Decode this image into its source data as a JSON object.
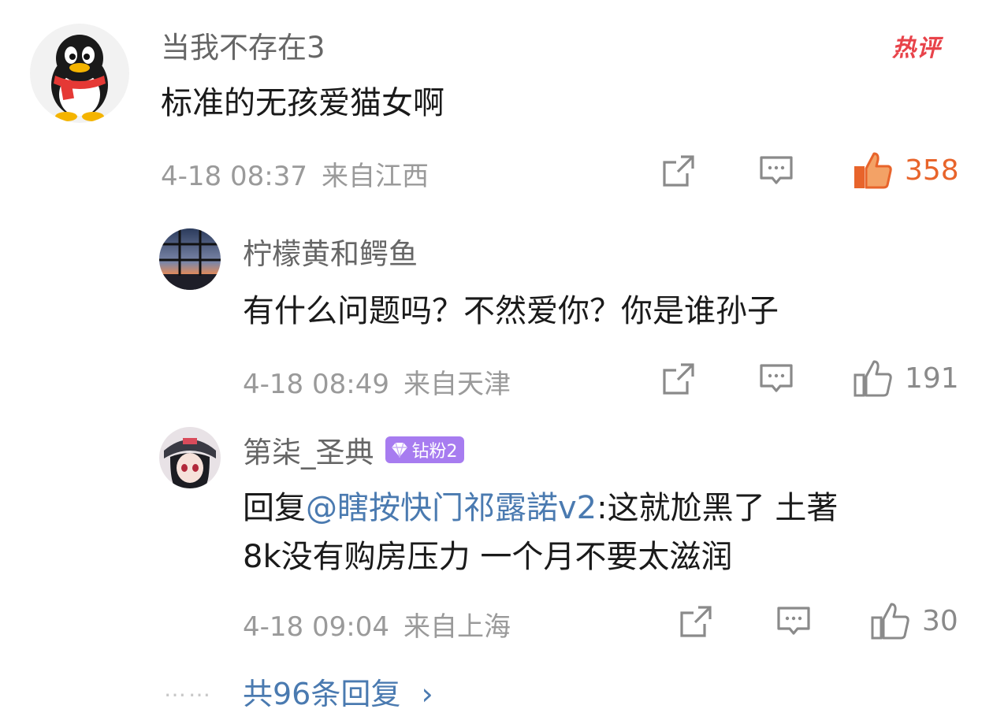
{
  "main_comment": {
    "username": "当我不存在3",
    "text": "标准的无孩爱猫女啊",
    "time": "4-18 08:37",
    "location": "来自江西",
    "likes": "358",
    "tag": "热评"
  },
  "replies": [
    {
      "username": "柠檬黄和鳄鱼",
      "text": "有什么问题吗？不然爱你？你是谁孙子",
      "time": "4-18 08:49",
      "location": "来自天津",
      "likes": "191"
    },
    {
      "username": "第柒_圣典",
      "badge": "钻粉2",
      "reply_prefix": "回复",
      "mention": "@瞎按快门祁露諾v2",
      "text_line1": ":这就尬黑了 土著",
      "text_line2": "8k没有购房压力 一个月不要太滋润",
      "time": "4-18 09:04",
      "location": "来自上海",
      "likes": "30"
    }
  ],
  "more_replies": {
    "dots": "……",
    "label": "共96条回复",
    "chevron": "›"
  },
  "colors": {
    "accent_orange": "#e8642b",
    "link_blue": "#4a7ab0",
    "hot_red": "#e8434a",
    "badge_purple": "#a77cf0"
  },
  "icons": [
    "qq-penguin-avatar",
    "forward-icon",
    "comment-icon",
    "like-icon",
    "diamond-icon",
    "chevron-right-icon"
  ]
}
